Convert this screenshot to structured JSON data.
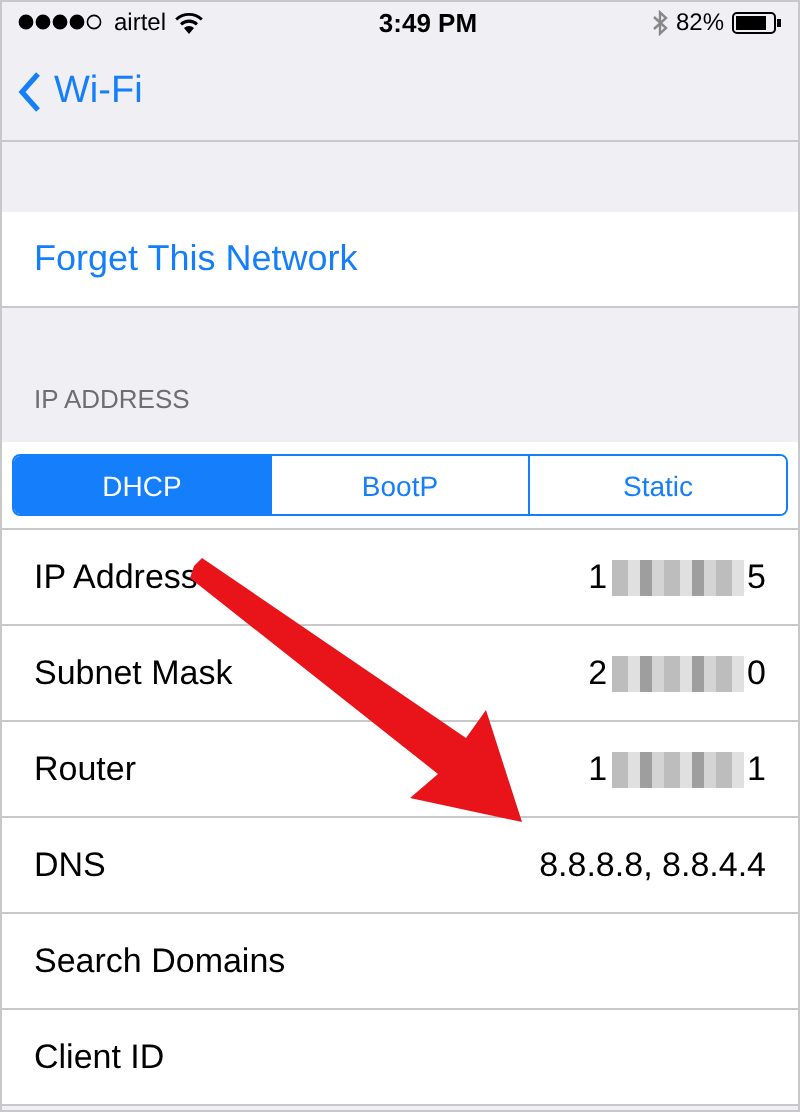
{
  "status_bar": {
    "carrier": "airtel",
    "time": "3:49 PM",
    "battery": "82%"
  },
  "nav": {
    "back": "Wi-Fi"
  },
  "forget": "Forget This Network",
  "section_header": "IP ADDRESS",
  "segments": [
    {
      "label": "DHCP",
      "selected": true
    },
    {
      "label": "BootP",
      "selected": false
    },
    {
      "label": "Static",
      "selected": false
    }
  ],
  "rows": [
    {
      "label": "IP Address",
      "value_start": "1",
      "value_end": "5",
      "redacted": true
    },
    {
      "label": "Subnet Mask",
      "value_start": "2",
      "value_end": "0",
      "redacted": true
    },
    {
      "label": "Router",
      "value_start": "1",
      "value_end": "1",
      "redacted": true
    },
    {
      "label": "DNS",
      "value_start": "8.8.8.8, 8.8.4.4"
    },
    {
      "label": "Search Domains"
    },
    {
      "label": "Client ID"
    }
  ]
}
